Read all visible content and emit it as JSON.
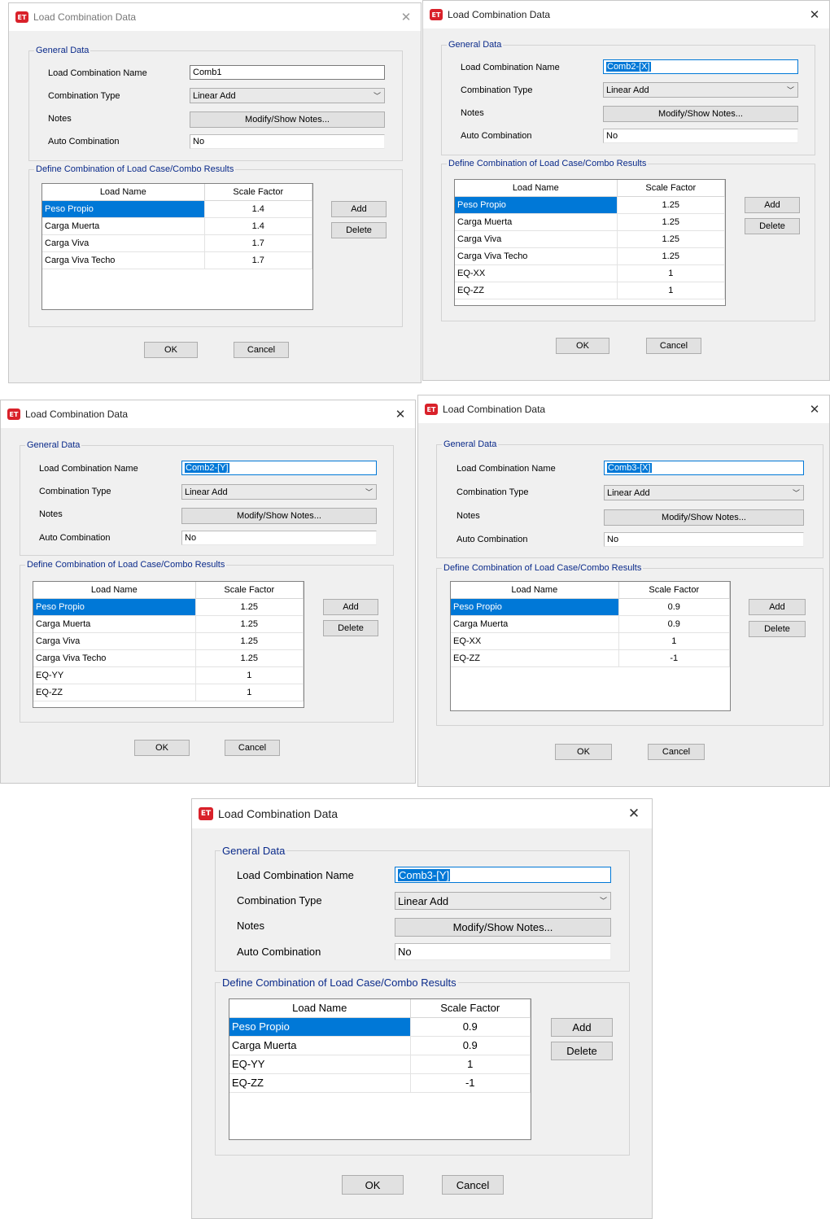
{
  "common": {
    "window_title": "Load Combination Data",
    "app_icon_text": "ET",
    "close_symbol": "✕",
    "general_group": "General Data",
    "name_label": "Load Combination Name",
    "type_label": "Combination Type",
    "notes_label": "Notes",
    "auto_label": "Auto Combination",
    "define_group": "Define Combination of Load Case/Combo Results",
    "col_load_name": "Load Name",
    "col_scale_factor": "Scale Factor",
    "add_label": "Add",
    "delete_label": "Delete",
    "ok_label": "OK",
    "cancel_label": "Cancel",
    "notes_button_label": "Modify/Show Notes...",
    "dropdown_arrow": "﹀"
  },
  "dialogs": [
    {
      "combination_name": "Comb1",
      "combination_type": "Linear Add",
      "auto_combination": "No",
      "rows": [
        {
          "load": "Peso Propio",
          "factor": "1.4"
        },
        {
          "load": "Carga Muerta",
          "factor": "1.4"
        },
        {
          "load": "Carga Viva",
          "factor": "1.7"
        },
        {
          "load": "Carga Viva Techo",
          "factor": "1.7"
        }
      ]
    },
    {
      "combination_name": "Comb2-[X]",
      "combination_type": "Linear Add",
      "auto_combination": "No",
      "rows": [
        {
          "load": "Peso Propio",
          "factor": "1.25"
        },
        {
          "load": "Carga Muerta",
          "factor": "1.25"
        },
        {
          "load": "Carga Viva",
          "factor": "1.25"
        },
        {
          "load": "Carga Viva Techo",
          "factor": "1.25"
        },
        {
          "load": "EQ-XX",
          "factor": "1"
        },
        {
          "load": "EQ-ZZ",
          "factor": "1"
        }
      ]
    },
    {
      "combination_name": "Comb2-[Y]",
      "combination_type": "Linear Add",
      "auto_combination": "No",
      "rows": [
        {
          "load": "Peso Propio",
          "factor": "1.25"
        },
        {
          "load": "Carga Muerta",
          "factor": "1.25"
        },
        {
          "load": "Carga Viva",
          "factor": "1.25"
        },
        {
          "load": "Carga Viva Techo",
          "factor": "1.25"
        },
        {
          "load": "EQ-YY",
          "factor": "1"
        },
        {
          "load": "EQ-ZZ",
          "factor": "1"
        }
      ]
    },
    {
      "combination_name": "Comb3-[X]",
      "combination_type": "Linear Add",
      "auto_combination": "No",
      "rows": [
        {
          "load": "Peso Propio",
          "factor": "0.9"
        },
        {
          "load": "Carga Muerta",
          "factor": "0.9"
        },
        {
          "load": "EQ-XX",
          "factor": "1"
        },
        {
          "load": "EQ-ZZ",
          "factor": "-1"
        }
      ]
    },
    {
      "combination_name": "Comb3-[Y]",
      "combination_type": "Linear Add",
      "auto_combination": "No",
      "rows": [
        {
          "load": "Peso Propio",
          "factor": "0.9"
        },
        {
          "load": "Carga Muerta",
          "factor": "0.9"
        },
        {
          "load": "EQ-YY",
          "factor": "1"
        },
        {
          "load": "EQ-ZZ",
          "factor": "-1"
        }
      ]
    }
  ]
}
